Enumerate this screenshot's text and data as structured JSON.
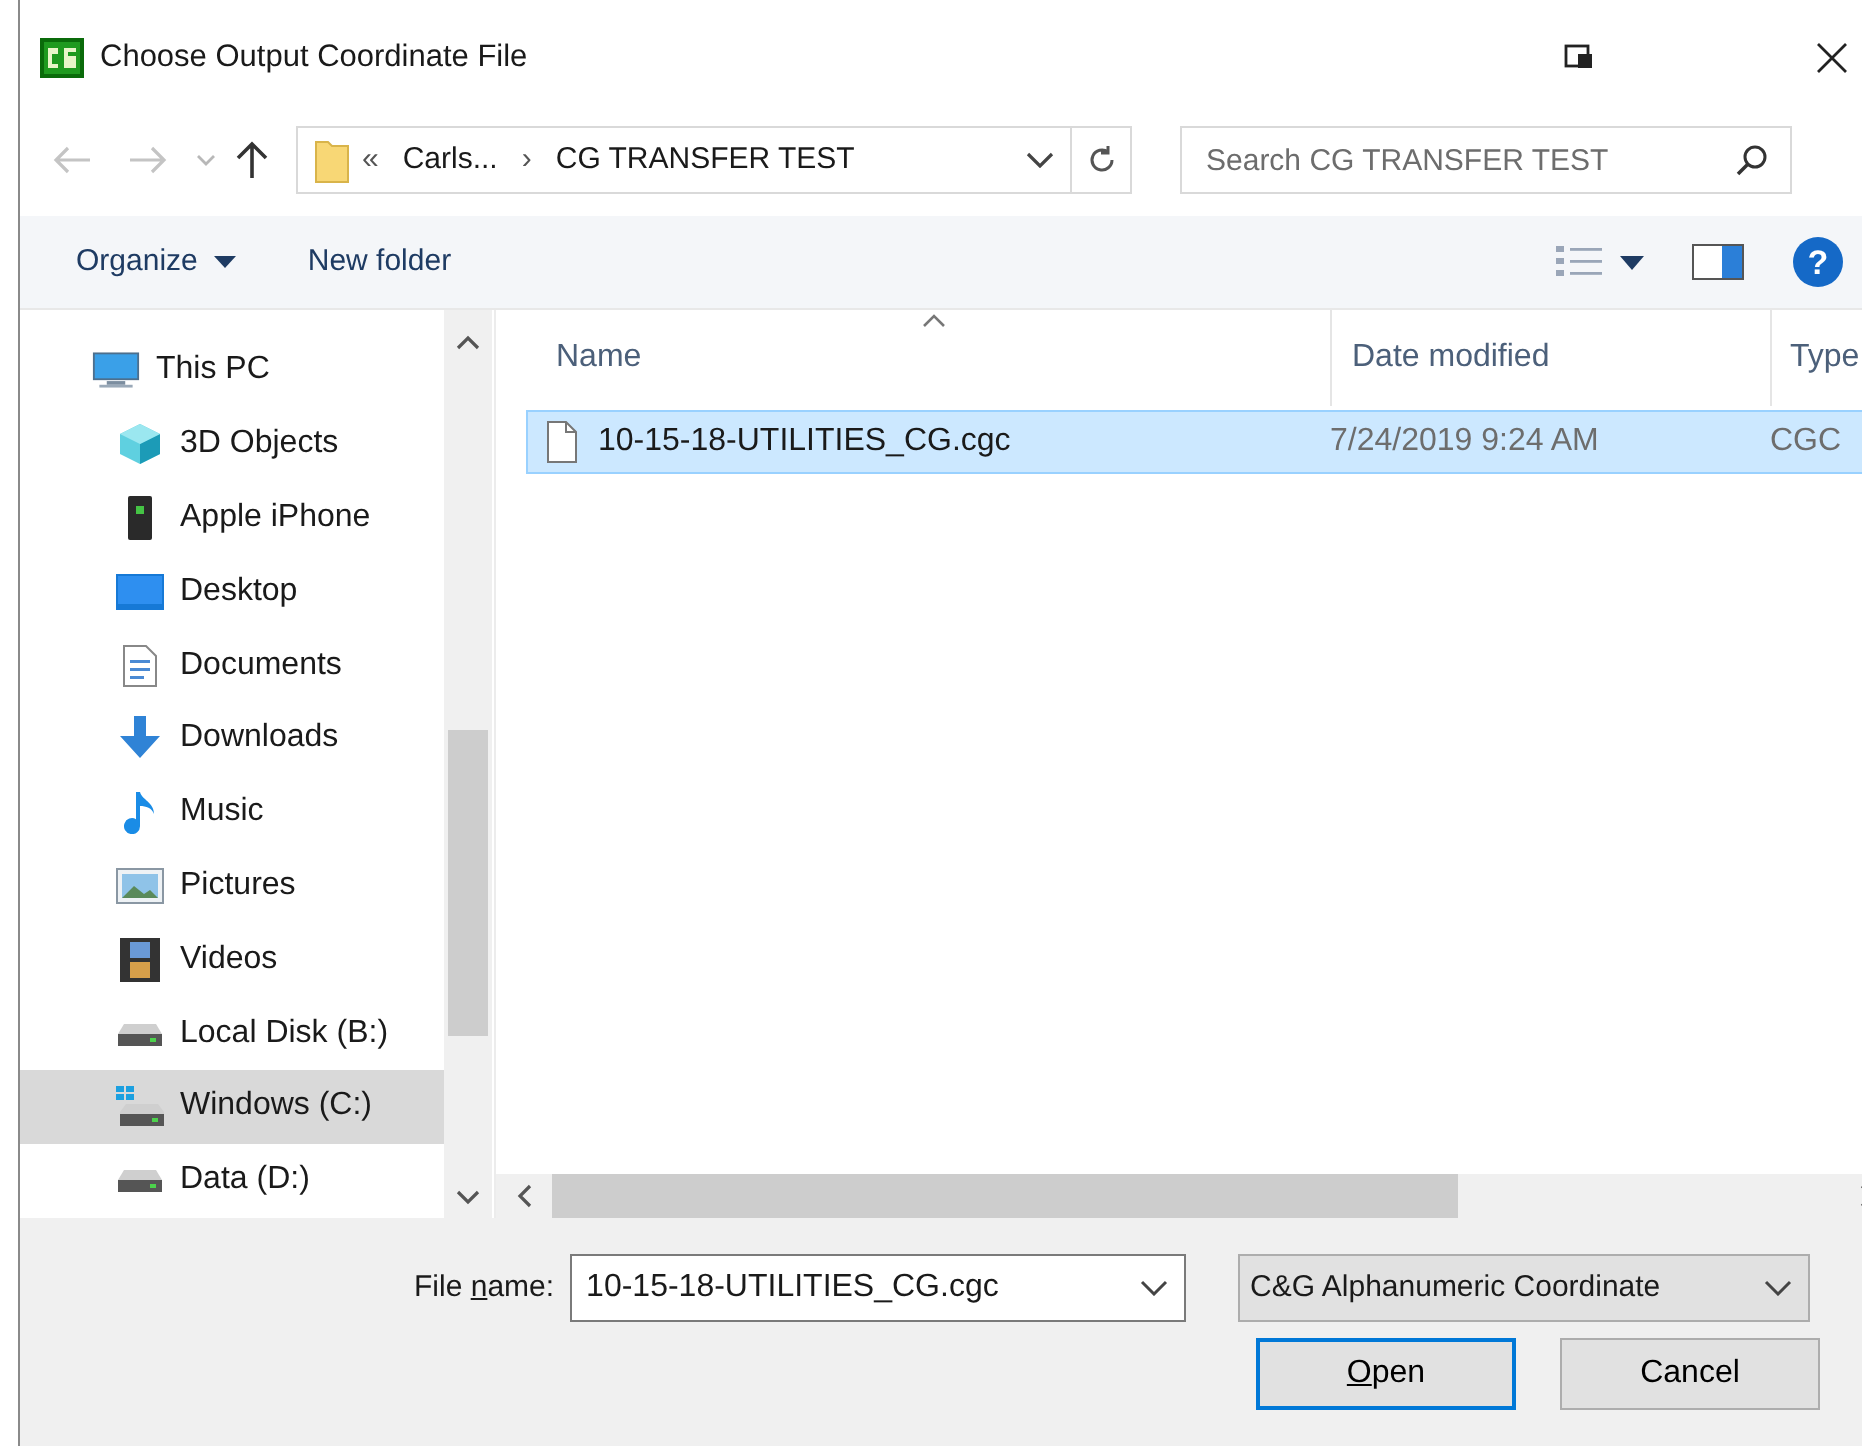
{
  "window": {
    "title": "Choose Output Coordinate File"
  },
  "navigation": {
    "back_disabled": true,
    "forward_disabled": true
  },
  "address_bar": {
    "overflow": "«",
    "segments": [
      "Carls...",
      "CG TRANSFER TEST"
    ],
    "separator": "›"
  },
  "search": {
    "placeholder": "Search CG TRANSFER TEST"
  },
  "toolbar": {
    "buttons": [
      "Organize",
      "New folder"
    ],
    "help": "?"
  },
  "sidebar": {
    "items": [
      {
        "label": "This PC",
        "kind": "pc",
        "selected": false,
        "children": [
          {
            "label": "3D Objects",
            "kind": "objects",
            "selected": false
          },
          {
            "label": "Apple iPhone",
            "kind": "phone",
            "selected": false
          },
          {
            "label": "Desktop",
            "kind": "desktop",
            "selected": false
          },
          {
            "label": "Documents",
            "kind": "documents",
            "selected": false
          },
          {
            "label": "Downloads",
            "kind": "downloads",
            "selected": false
          },
          {
            "label": "Music",
            "kind": "music",
            "selected": false
          },
          {
            "label": "Pictures",
            "kind": "pictures",
            "selected": false
          },
          {
            "label": "Videos",
            "kind": "videos",
            "selected": false
          },
          {
            "label": "Local Disk (B:)",
            "kind": "drive",
            "selected": false
          },
          {
            "label": "Windows (C:)",
            "kind": "system",
            "selected": true
          },
          {
            "label": "Data (D:)",
            "kind": "drive",
            "selected": false
          }
        ]
      }
    ]
  },
  "file_list": {
    "columns": [
      "Name",
      "Date modified",
      "Type"
    ],
    "rows": [
      {
        "name": "10-15-18-UTILITIES_CG.cgc",
        "date_modified": "7/24/2019 9:24 AM",
        "type": "CGC",
        "selected": true
      }
    ]
  },
  "file_name": {
    "label": {
      "before": "File ",
      "key": "n",
      "after": "ame:"
    },
    "value": "10-15-18-UTILITIES_CG.cgc"
  },
  "file_type": {
    "value": "C&G Alphanumeric Coordinate"
  },
  "buttons": [
    {
      "label": {
        "key": "O",
        "after": "pen"
      },
      "focused": true
    },
    {
      "label": {
        "before": "Cancel"
      },
      "focused": false
    }
  ]
}
